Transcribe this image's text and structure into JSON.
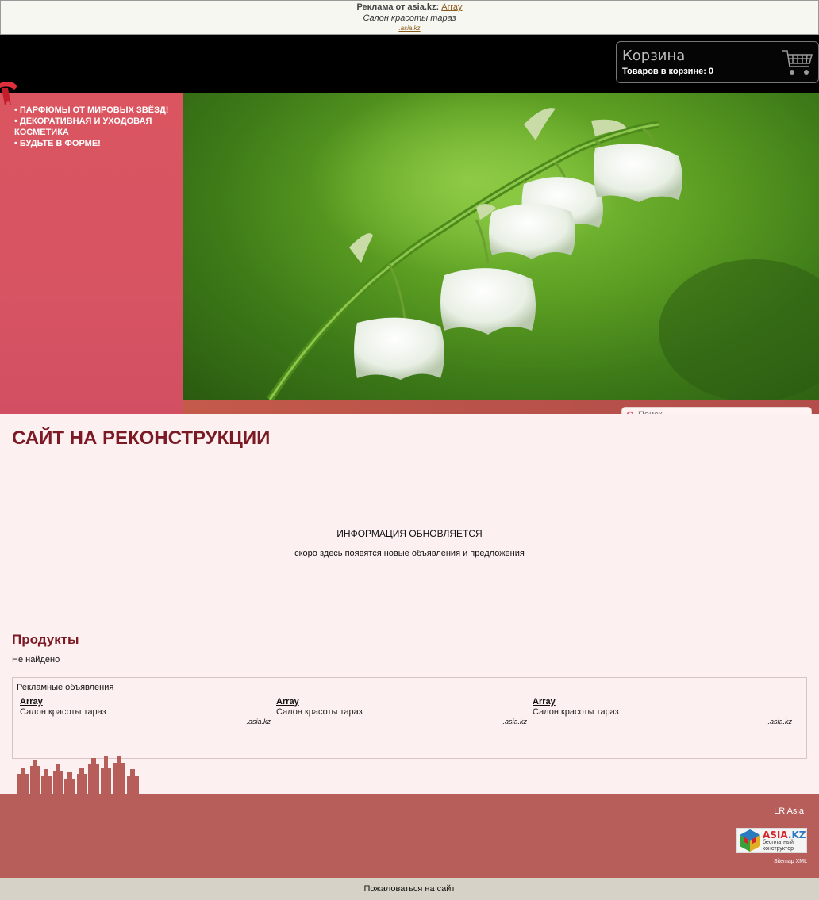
{
  "topad": {
    "label": "Реклама от asia.kz:",
    "link": "Array",
    "text": "Салон красоты тараз",
    "url": ".asia.kz"
  },
  "cart": {
    "title": "Корзина",
    "count_label": "Товаров в корзине: 0"
  },
  "menu": [
    {
      "label": "ПАРФЮМЫ ОТ МИРОВЫХ ЗВЁЗД!"
    },
    {
      "label": "ДЕКОРАТИВНАЯ И УХОДОВАЯ КОСМЕТИКА"
    },
    {
      "label": "БУДЬТЕ В ФОРМЕ!"
    }
  ],
  "search": {
    "placeholder": "Поиск"
  },
  "main": {
    "title": "САЙТ НА РЕКОНСТРУКЦИИ",
    "info_title": "ИНФОРМАЦИЯ ОБНОВЛЯЕТСЯ",
    "info_text": "скоро здесь появятся новые объявления и предложения"
  },
  "products": {
    "title": "Продукты",
    "empty": "Не найдено"
  },
  "ads": {
    "header": "Рекламные объявления",
    "items": [
      {
        "title": "Array",
        "desc": "Салон красоты тараз",
        "url": ".asia.kz"
      },
      {
        "title": "Array",
        "desc": "Салон красоты тараз",
        "url": ".asia.kz"
      },
      {
        "title": "Array",
        "desc": "Салон красоты тараз",
        "url": ".asia.kz"
      }
    ]
  },
  "footer": {
    "owner": "LR Asia",
    "logo_brand": "ASIA",
    "logo_brand_tld": ".KZ",
    "logo_sub1": "бесплатный",
    "logo_sub2": "конструктор",
    "sitemap": "Sitemap XML"
  },
  "complain": "Пожаловаться на сайт",
  "colors": {
    "accent": "#7b1a25",
    "sidebar": "#d75463",
    "footer": "#b75e5b",
    "content_bg": "#fdf0f0"
  }
}
